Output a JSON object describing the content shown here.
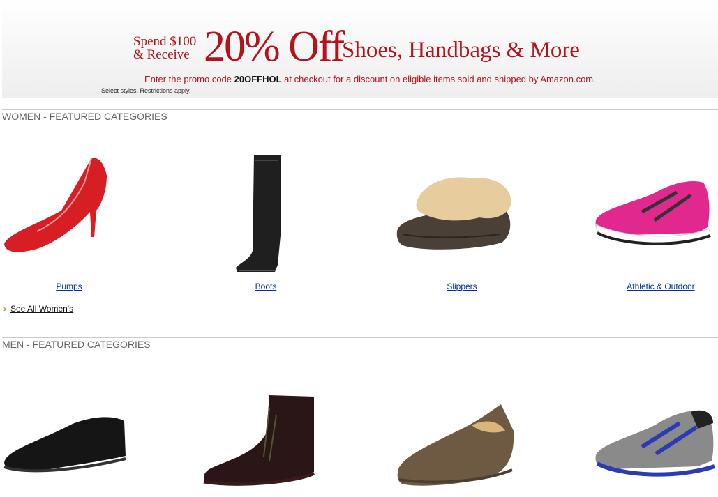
{
  "banner": {
    "spend_line1": "Spend $100",
    "spend_line2": "& Receive",
    "headline": "20% Off",
    "categories": "Shoes, Handbags & More",
    "promo_prefix": "Enter the promo code ",
    "promo_code": "20OFFHOL",
    "promo_suffix": " at checkout for a discount on eligible items sold and shipped by Amazon.com.",
    "fine_print": "Select styles. Restrictions apply."
  },
  "women": {
    "title": "WOMEN - FEATURED CATEGORIES",
    "items": [
      {
        "label": "Pumps"
      },
      {
        "label": "Boots"
      },
      {
        "label": "Slippers"
      },
      {
        "label": "Athletic & Outdoor"
      }
    ],
    "see_all": "See All Women's"
  },
  "men": {
    "title": "MEN - FEATURED CATEGORIES"
  },
  "colors": {
    "accent": "#b5121b",
    "link": "#003399",
    "chevron": "#e47911"
  }
}
